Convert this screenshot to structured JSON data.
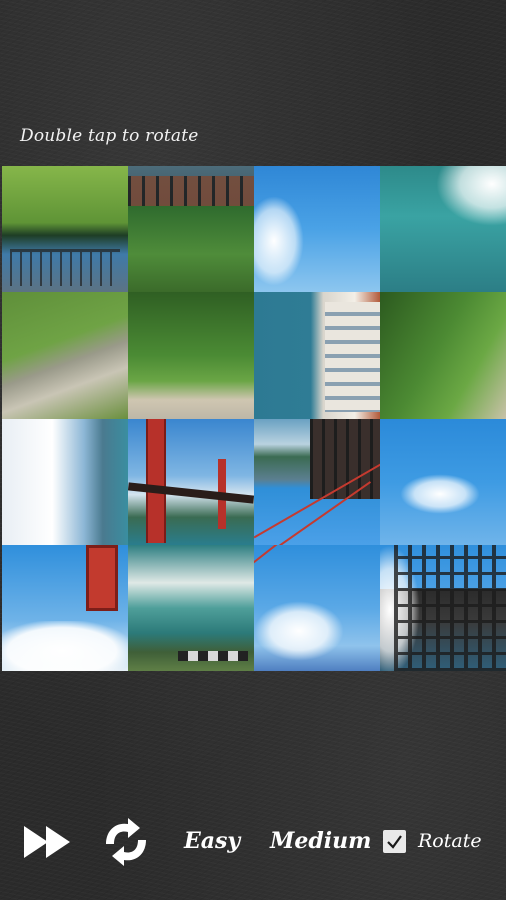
{
  "hint": "Double tap to rotate",
  "board": {
    "tiles": [
      {
        "piece": "hill-bridge"
      },
      {
        "piece": "tower-bar"
      },
      {
        "piece": "sky-cloud"
      },
      {
        "piece": "sea-wave"
      },
      {
        "piece": "path-grass"
      },
      {
        "piece": "green-cliff"
      },
      {
        "piece": "house-coast"
      },
      {
        "piece": "cliff-green"
      },
      {
        "piece": "clouds-shore"
      },
      {
        "piece": "golden-gate-tower"
      },
      {
        "piece": "bridge-cables"
      },
      {
        "piece": "sky-cloud-2"
      },
      {
        "piece": "sky-tower-red"
      },
      {
        "piece": "beach-surf"
      },
      {
        "piece": "sky-cable"
      },
      {
        "piece": "bridge-steel"
      }
    ]
  },
  "controls": {
    "skip_icon": "fast-forward-icon",
    "rotate_icon": "rotate-arrows-icon",
    "easy_label": "Easy",
    "medium_label": "Medium",
    "rotate_label": "Rotate",
    "rotate_checked": true
  }
}
